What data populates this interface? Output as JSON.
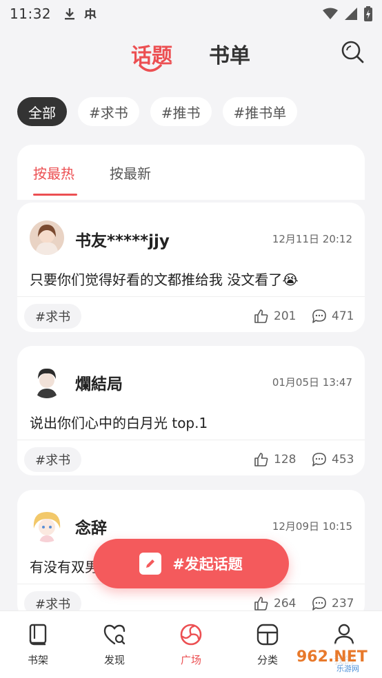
{
  "status_bar": {
    "time": "11:32"
  },
  "header": {
    "tab_topic": "话题",
    "tab_booklist": "书单"
  },
  "filters": [
    {
      "label": "全部",
      "active": true
    },
    {
      "label": "#求书",
      "active": false
    },
    {
      "label": "#推书",
      "active": false
    },
    {
      "label": "#推书单",
      "active": false
    }
  ],
  "sort": {
    "hot": "按最热",
    "new": "按最新"
  },
  "posts": [
    {
      "name": "书友*****jjy",
      "time": "12月11日 20:12",
      "text": "只要你们觉得好看的文都推给我 没文看了😭",
      "tag": "#求书",
      "likes": "201",
      "comments": "471"
    },
    {
      "name": "爛結局",
      "time": "01月05日 13:47",
      "text": "说出你们心中的白月光 top.1",
      "tag": "#求书",
      "likes": "128",
      "comments": "453"
    },
    {
      "name": "念辞",
      "time": "12月09日 10:15",
      "text": "有没有双男",
      "tag": "#求书",
      "likes": "264",
      "comments": "237"
    }
  ],
  "fab": {
    "label": "#发起话题"
  },
  "nav": [
    {
      "label": "书架"
    },
    {
      "label": "发现"
    },
    {
      "label": "广场"
    },
    {
      "label": "分类"
    },
    {
      "label": "我的"
    }
  ],
  "colors": {
    "accent": "#ec4f52",
    "fab": "#f45a5c",
    "background": "#f4f4f6"
  },
  "watermark": {
    "text": "962.NET",
    "subtext": "乐游网"
  }
}
